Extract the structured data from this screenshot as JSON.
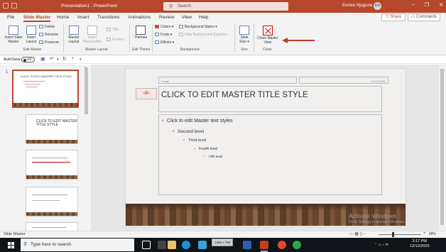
{
  "window": {
    "title": "Presentation1  -  PowerPoint",
    "search_placeholder": "Search",
    "user_name": "Eunice Njuguna",
    "user_initials": "EN",
    "controls": [
      "–",
      "❐",
      "✕"
    ]
  },
  "tabs": [
    "File",
    "Slide Master",
    "Home",
    "Insert",
    "Transitions",
    "Animations",
    "Review",
    "View",
    "Help"
  ],
  "active_tab": "Slide Master",
  "share_label": "Share",
  "comments_label": "Comments",
  "ribbon": {
    "edit_master": {
      "group_label": "Edit Master",
      "insert_slide_master": "Insert Slide Master",
      "insert_layout": "Insert Layout",
      "delete": "Delete",
      "rename": "Rename",
      "preserve": "Preserve"
    },
    "master_layout": {
      "group_label": "Master Layout",
      "master_layout": "Master Layout",
      "insert_placeholder": "Insert Placeholder",
      "title": "Title",
      "footers": "Footers"
    },
    "edit_theme": {
      "group_label": "Edit Theme",
      "themes": "Themes"
    },
    "background": {
      "group_label": "Background",
      "colors": "Colors",
      "fonts": "Fonts",
      "effects": "Effects",
      "background_styles": "Background Styles",
      "hide_background_graphics": "Hide Background Graphics"
    },
    "size": {
      "group_label": "Size",
      "slide_size": "Slide Size"
    },
    "close": {
      "group_label": "Close",
      "close_master_view": "Close Master View"
    }
  },
  "qat": {
    "autosave_label": "AutoSave",
    "autosave_state": "Off"
  },
  "thumbnails": {
    "first_number": "1",
    "master_thumb_title": "CLICK TO EDIT MASTER TITLE STYLE",
    "layout_thumb_title": "CLICK TO EDIT MASTER TITLE STYLE"
  },
  "slide": {
    "footer_left": "Footer",
    "footer_right": "12/12/2020",
    "number_placeholder": "‹#›",
    "title": "CLICK TO EDIT MASTER TITLE STYLE",
    "body_levels": [
      "Click to edit Master text styles",
      "Second level",
      "Third level",
      "Fourth level",
      "Fifth level"
    ]
  },
  "watermark": {
    "title": "Activate Windows",
    "subtitle": "Go to Settings to activate Windows."
  },
  "status": {
    "left": "Slide Master",
    "zoom": "68%",
    "zoom_fraction": 0.68
  },
  "taskbar": {
    "search_placeholder": "Type here to search",
    "tooltip": "1366 x 768",
    "time": "3:17 PM",
    "date": "12/12/2020"
  },
  "colors": {
    "accent": "#b7472a",
    "arrow": "#c0392b"
  }
}
